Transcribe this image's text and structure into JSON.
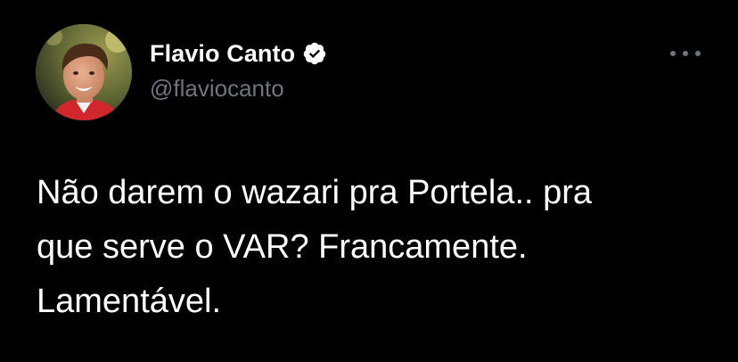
{
  "author": {
    "display_name": "Flavio Canto",
    "handle": "@flaviocanto",
    "verified": true,
    "avatar_icon": "profile-photo"
  },
  "tweet": {
    "text_lines": [
      "Não darem o wazari pra Portela.. pra",
      "que serve o VAR? Francamente.",
      "Lamentável."
    ]
  },
  "menu": {
    "icon": "more-options-icon"
  },
  "colors": {
    "background": "#000000",
    "text_primary": "#ffffff",
    "text_secondary": "#6e767d",
    "verified_badge": "#ffffff"
  }
}
